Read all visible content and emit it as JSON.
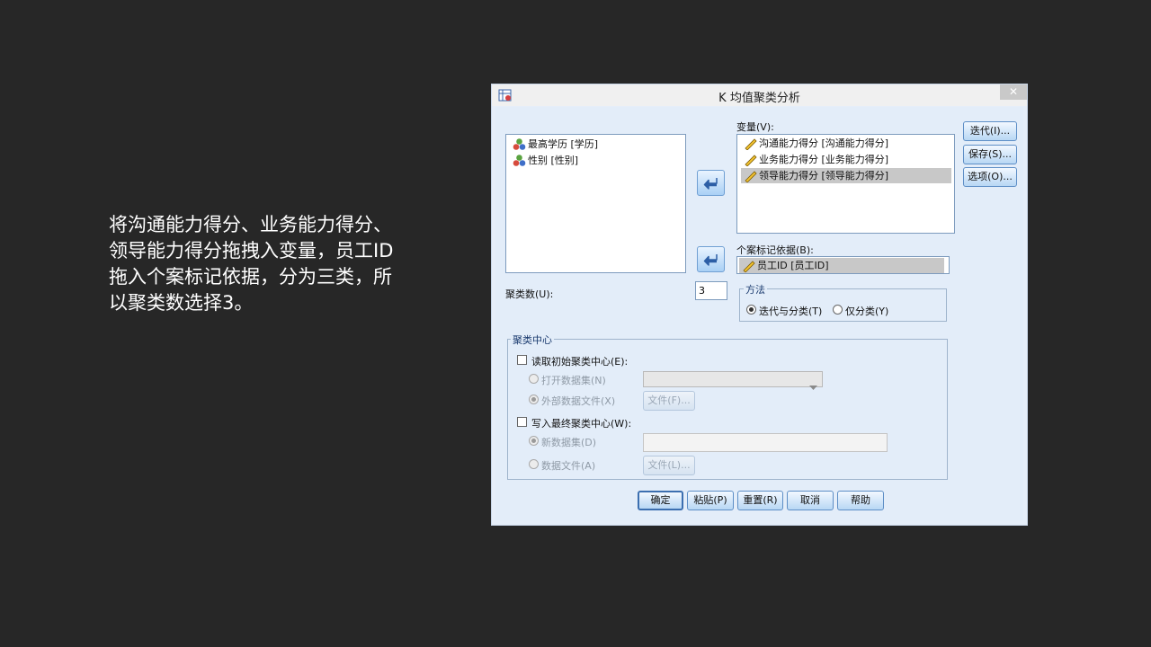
{
  "caption": "将沟通能力得分、业务能力得分、\n领导能力得分拖拽入变量，员工ID\n拖入个案标记依据，分为三类，所\n以聚类数选择3。",
  "dialog": {
    "title": "K 均值聚类分析",
    "close": "✕",
    "source_list": [
      {
        "label": "最高学历 [学历]",
        "icon": "nominal-variable-icon"
      },
      {
        "label": "性别 [性别]",
        "icon": "nominal-variable-icon"
      }
    ],
    "variables_label": "变量(V):",
    "variables": [
      {
        "label": "沟通能力得分 [沟通能力得分]",
        "icon": "scale-variable-icon",
        "selected": false
      },
      {
        "label": "业务能力得分 [业务能力得分]",
        "icon": "scale-variable-icon",
        "selected": false
      },
      {
        "label": "领导能力得分 [领导能力得分]",
        "icon": "scale-variable-icon",
        "selected": true
      }
    ],
    "case_label_label": "个案标记依据(B):",
    "case_label_value": "员工ID [员工ID]",
    "clusters_label": "聚类数(U):",
    "clusters_value": "3",
    "method": {
      "title": "方法",
      "options": [
        {
          "label": "迭代与分类(T)",
          "checked": true
        },
        {
          "label": "仅分类(Y)",
          "checked": false
        }
      ]
    },
    "cluster_centers": {
      "title": "聚类中心",
      "read_initial": "读取初始聚类中心(E):",
      "open_dataset": "打开数据集(N)",
      "external_file": "外部数据文件(X)",
      "file_button_1": "文件(F)...",
      "write_final": "写入最终聚类中心(W):",
      "new_dataset": "新数据集(D)",
      "data_file": "数据文件(A)",
      "file_button_2": "文件(L)..."
    },
    "side_buttons": [
      "迭代(I)...",
      "保存(S)...",
      "选项(O)..."
    ],
    "bottom_buttons": [
      "确定",
      "粘贴(P)",
      "重置(R)",
      "取消",
      "帮助"
    ]
  }
}
